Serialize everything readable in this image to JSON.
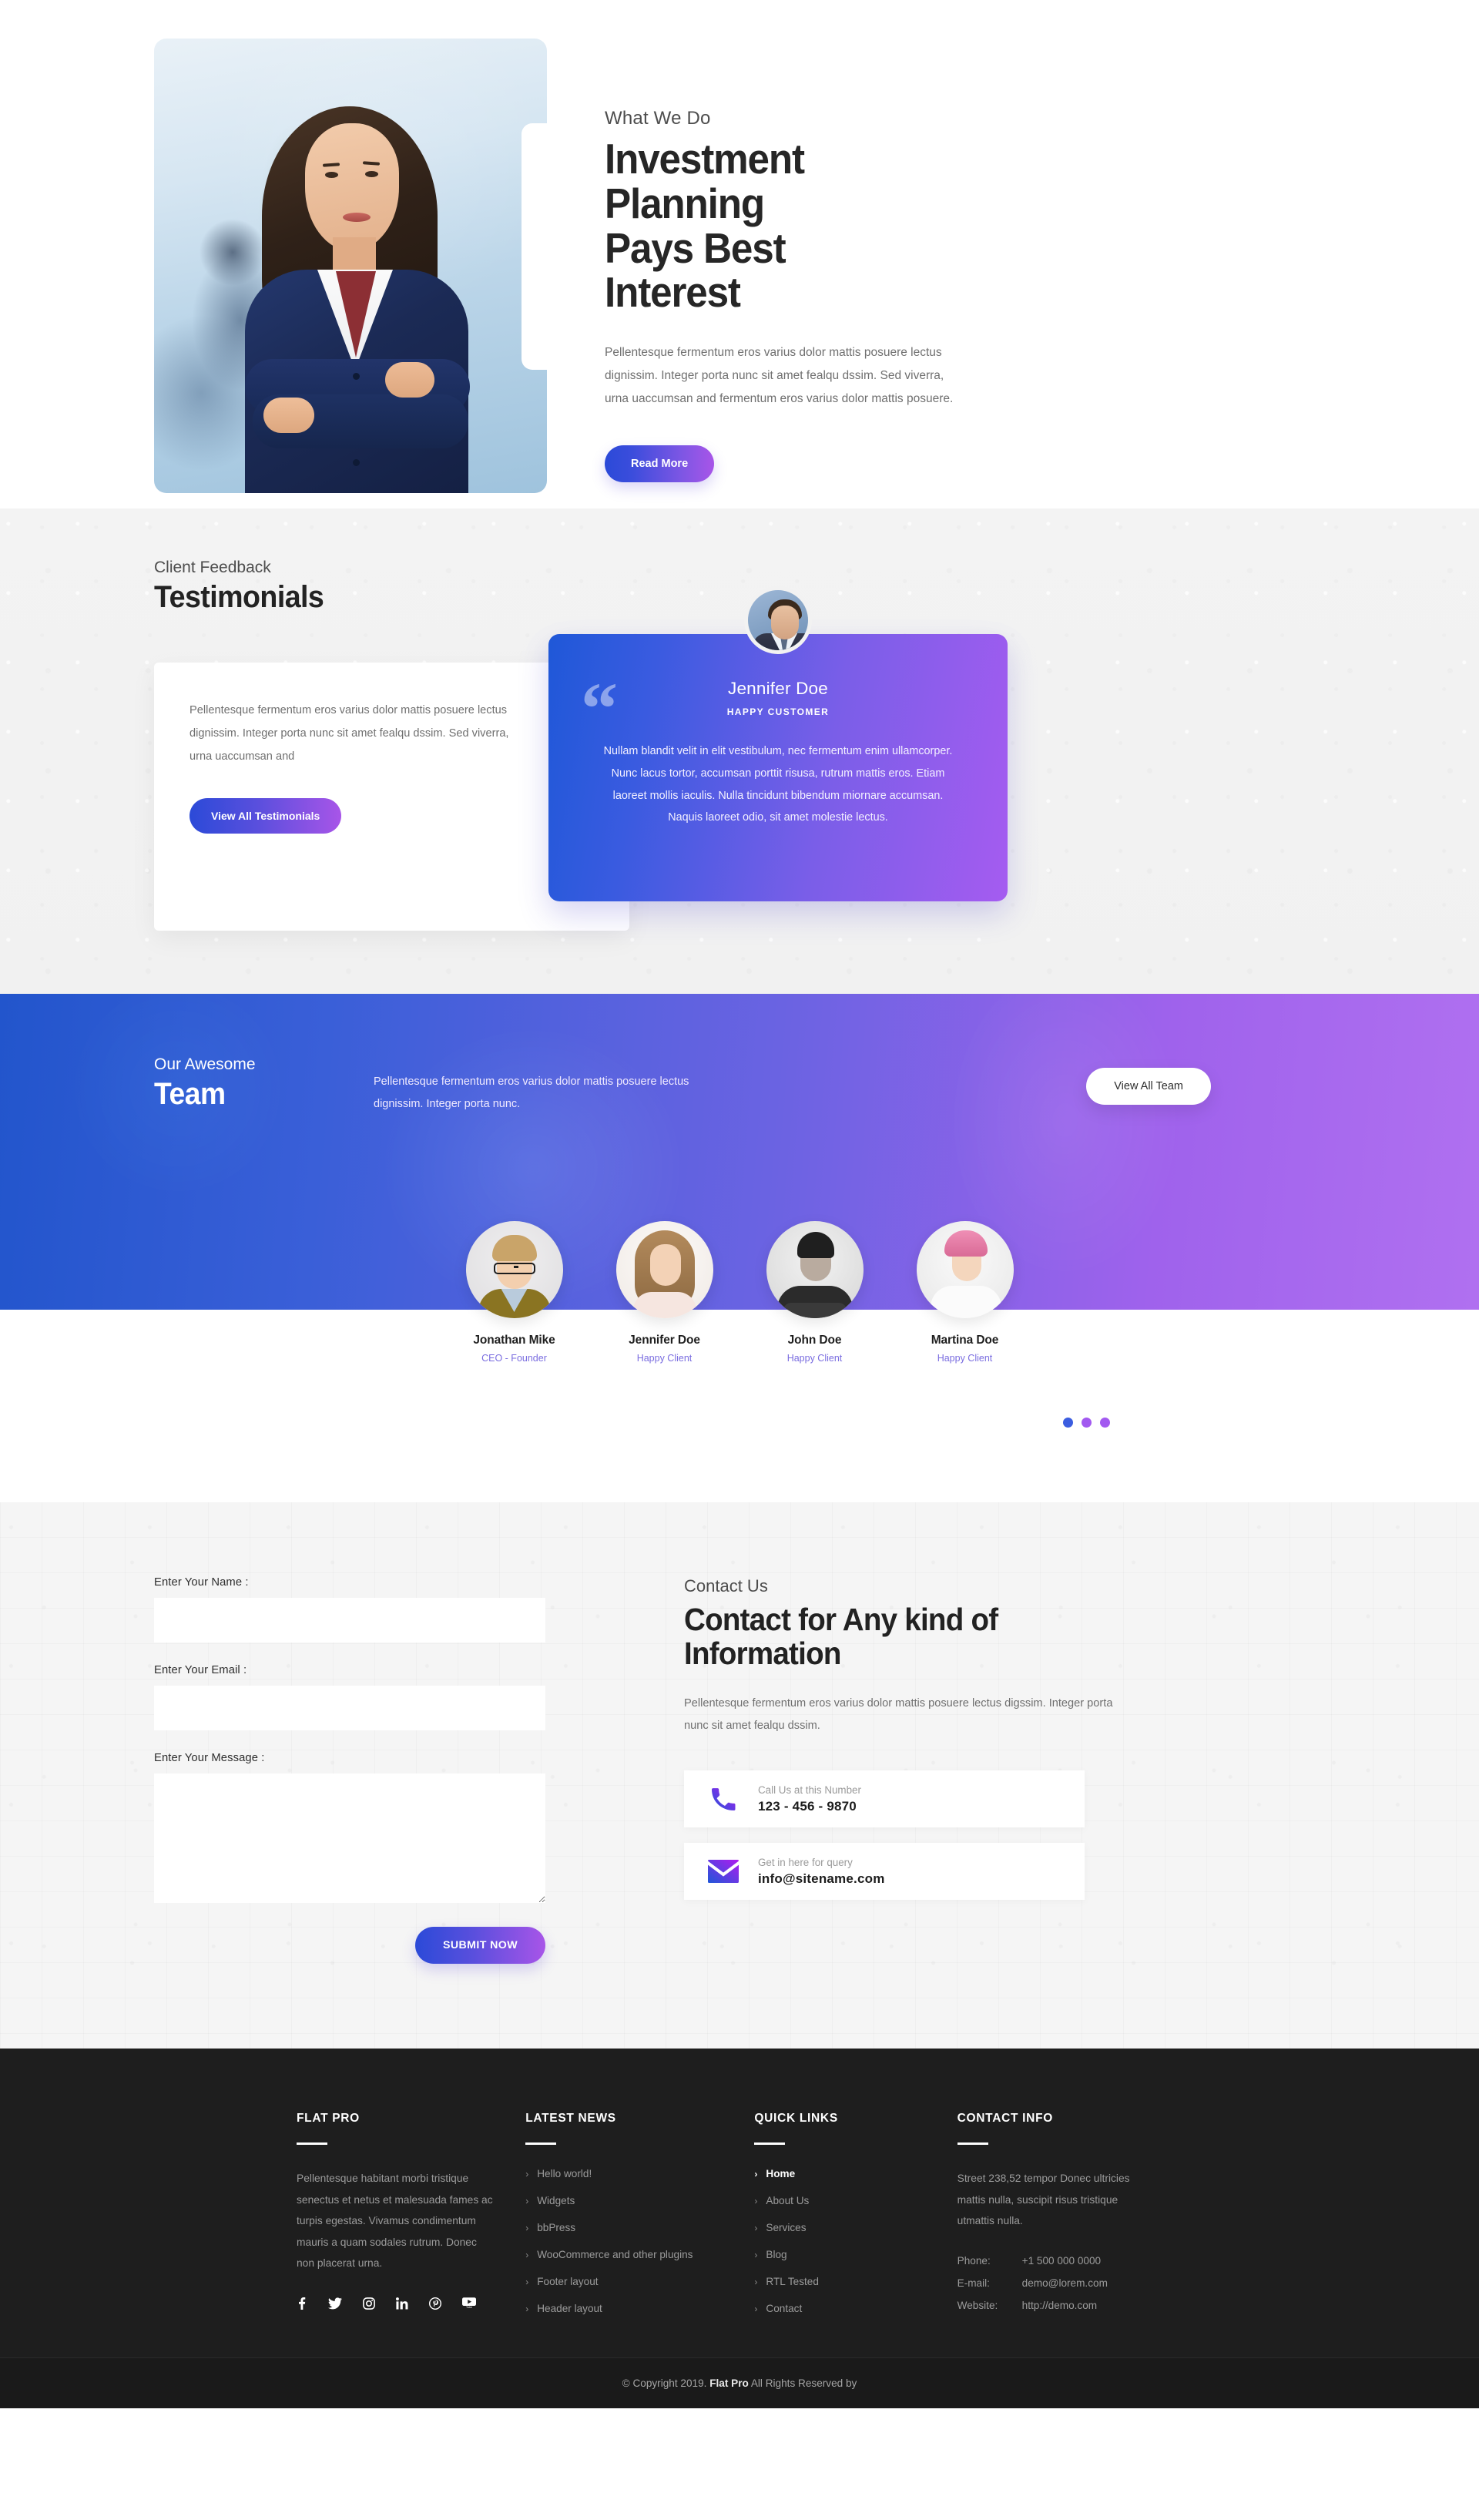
{
  "hero": {
    "eyebrow": "What We Do",
    "title_line1": "Investment Planning",
    "title_line2": "Pays Best Interest",
    "paragraph": "Pellentesque fermentum eros varius dolor mattis posuere lectus dignissim. Integer porta nunc sit amet fealqu dssim. Sed viverra, urna uaccumsan and fermentum eros varius dolor mattis posuere.",
    "button": "Read More",
    "image_alt": "businesswoman-portrait"
  },
  "testimonials": {
    "eyebrow": "Client Feedback",
    "title": "Testimonials",
    "summary": "Pellentesque fermentum eros varius dolor mattis posuere lectus dignissim. Integer porta nunc sit amet fealqu dssim. Sed viverra, urna uaccumsan and",
    "button": "View All Testimonials",
    "card": {
      "name": "Jennifer Doe",
      "role": "HAPPY CUSTOMER",
      "quote": "Nullam blandit velit in elit vestibulum, nec fermentum enim ullamcorper. Nunc lacus tortor, accumsan porttit risusa, rutrum mattis eros. Etiam laoreet mollis iaculis. Nulla tincidunt bibendum miornare accumsan. Naquis laoreet odio, sit amet molestie lectus.",
      "avatar_alt": "businessman-avatar"
    },
    "pagination": [
      {
        "active": true
      },
      {
        "active": false
      },
      {
        "active": false
      }
    ]
  },
  "team": {
    "eyebrow": "Our Awesome",
    "title": "Team",
    "description": "Pellentesque fermentum eros varius dolor mattis posuere lectus dignissim. Integer porta nunc.",
    "button": "View All Team",
    "members": [
      {
        "name": "Jonathan Mike",
        "role": "CEO - Founder"
      },
      {
        "name": "Jennifer Doe",
        "role": "Happy Client"
      },
      {
        "name": "John Doe",
        "role": "Happy Client"
      },
      {
        "name": "Martina Doe",
        "role": "Happy Client"
      }
    ]
  },
  "contact": {
    "form": {
      "name_label": "Enter Your Name :",
      "email_label": "Enter Your Email :",
      "message_label": "Enter Your Message :",
      "name_value": "",
      "email_value": "",
      "message_value": "",
      "submit": "SUBMIT NOW"
    },
    "eyebrow": "Contact Us",
    "title_line1": "Contact for Any kind of",
    "title_line2": "Information",
    "description": "Pellentesque fermentum eros varius dolor mattis posuere lectus digssim. Integer porta nunc sit amet fealqu dssim.",
    "cards": [
      {
        "icon": "phone-icon",
        "label": "Call Us at this Number",
        "value": "123 - 456 - 9870"
      },
      {
        "icon": "envelope-icon",
        "label": "Get in here for query",
        "value": "info@sitename.com"
      }
    ]
  },
  "footer": {
    "about": {
      "title": "FLAT PRO",
      "text": "Pellentesque habitant morbi tristique senectus et netus et malesuada fames ac turpis egestas. Vivamus condimentum mauris a quam sodales rutrum. Donec non placerat urna.",
      "social": [
        "facebook-icon",
        "twitter-icon",
        "instagram-icon",
        "linkedin-icon",
        "pinterest-icon",
        "youtube-icon"
      ]
    },
    "news": {
      "title": "LATEST NEWS",
      "items": [
        "Hello world!",
        "Widgets",
        "bbPress",
        "WooCommerce and other plugins",
        "Footer layout",
        "Header layout"
      ]
    },
    "links": {
      "title": "QUICK LINKS",
      "items": [
        {
          "label": "Home",
          "active": true
        },
        {
          "label": "About Us",
          "active": false
        },
        {
          "label": "Services",
          "active": false
        },
        {
          "label": "Blog",
          "active": false
        },
        {
          "label": "RTL Tested",
          "active": false
        },
        {
          "label": "Contact",
          "active": false
        }
      ]
    },
    "contact_info": {
      "title": "CONTACT INFO",
      "address": "Street 238,52 tempor Donec ultricies mattis nulla, suscipit risus tristique utmattis nulla.",
      "rows": [
        {
          "key": "Phone:",
          "value": "+1 500 000 0000"
        },
        {
          "key": "E-mail:",
          "value": "demo@lorem.com"
        },
        {
          "key": "Website:",
          "value": "http://demo.com"
        }
      ]
    },
    "copyright_pre": "© Copyright 2019. ",
    "copyright_brand": "Flat Pro",
    "copyright_post": " All Rights Reserved by"
  },
  "colors": {
    "accent_blue": "#2b4ad8",
    "accent_purple": "#a855e8",
    "dark_footer": "#1e1e1e",
    "role_purple": "#7a6de0"
  }
}
